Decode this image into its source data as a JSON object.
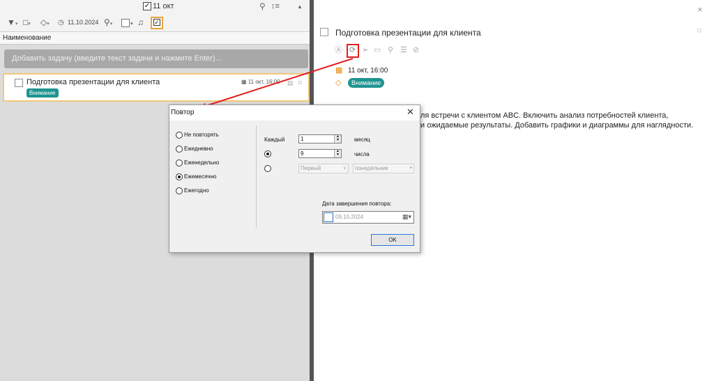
{
  "left_panel": {
    "date_filter_label": "11 окт",
    "toolbar": {
      "date_value": "11.10.2024"
    },
    "column_header": "Наименование",
    "add_task_placeholder": "Добавить задачу (введите текст задачи и нажмите Enter)...",
    "task": {
      "title": "Подготовка презентации для клиента",
      "tag": "Внимание",
      "due": "11 окт, 16:00"
    }
  },
  "details_panel": {
    "title": "Подготовка презентации для клиента",
    "date": "11 окт, 16:00",
    "tag": "Внимание",
    "description_line1": "ля встречи с клиентом ABC. Включить анализ потребностей клиента,",
    "description_line2": "и ожидаемые результаты. Добавить графики и диаграммы для наглядности."
  },
  "dialog": {
    "title": "Повтор",
    "options": [
      "Не повторять",
      "Ежедневно",
      "Еженедельно",
      "Ежемесячно",
      "Ежегодно"
    ],
    "selected_option": "Ежемесячно",
    "every_label": "Каждый",
    "interval_value": "1",
    "interval_unit": "месяц",
    "day_value": "9",
    "day_unit": "числа",
    "ordinal_value": "Первый",
    "weekday_value": "понедельник",
    "end_date_label": "Дата завершения повтора:",
    "end_date_value": "09.10.2024",
    "ok_label": "OK"
  },
  "colors": {
    "tag": "#1e9490",
    "highlight": "#e02020",
    "accent_orange": "#f0a23c"
  }
}
